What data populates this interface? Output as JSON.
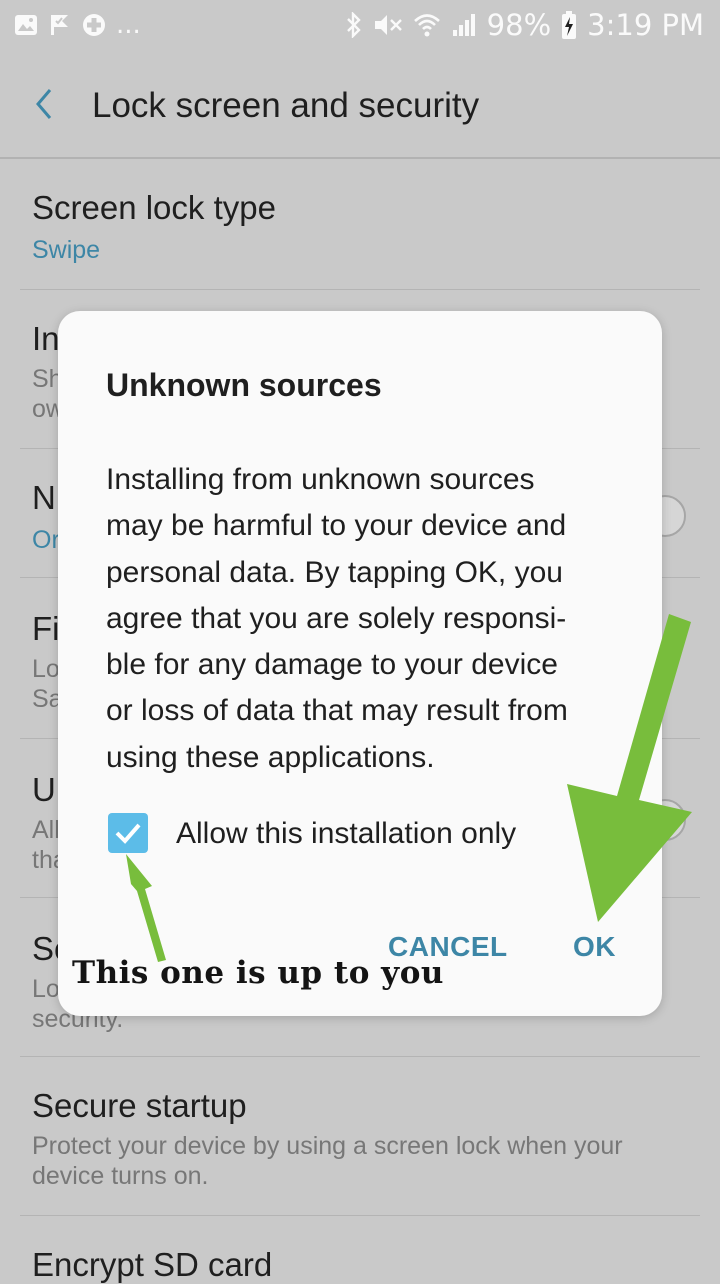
{
  "status_bar": {
    "left_icons": [
      "image-icon",
      "check-flag-icon",
      "medical-cross-icon"
    ],
    "more": "...",
    "battery": "98%",
    "time": "3:19 PM"
  },
  "app_bar": {
    "title": "Lock screen and security"
  },
  "settings": [
    {
      "title": "Screen lock type",
      "subtitle": "Swipe"
    },
    {
      "title": "In",
      "subtitle_lines": [
        "Sh",
        "ow"
      ]
    },
    {
      "title": "N",
      "subtitle": "Or"
    },
    {
      "title": "Fi",
      "subtitle_lines": [
        "Lo",
        "Sa"
      ]
    },
    {
      "title": "U",
      "subtitle_lines": [
        "All",
        "tha"
      ]
    },
    {
      "title": "Se",
      "subtitle_lines": [
        "Lo",
        "security."
      ]
    },
    {
      "title": "Secure startup",
      "subtitle": "Protect your device by using a screen lock when your device turns on."
    },
    {
      "title": "Encrypt SD card"
    }
  ],
  "dialog": {
    "title": "Unknown sources",
    "body": "Installing from unknown sources may be harmful to your device and personal data. By tapping OK, you agree that you are solely responsi­ble for any damage to your device or loss of data that may result from using these applications.",
    "body_lines": [
      "Installing from unknown sources",
      "may be harmful to your device and",
      "personal data. By tapping OK, you",
      "agree that you are solely responsi-",
      "ble for any damage to your device",
      "or loss of data that may result from",
      "using these applications."
    ],
    "checkbox_label": "Allow this installation only",
    "checkbox_checked": true,
    "cancel_label": "CANCEL",
    "ok_label": "OK"
  },
  "annotation": {
    "text": "This one is up to you",
    "arrow_color": "#78bd3c"
  },
  "colors": {
    "accent": "#3d86a6",
    "checkbox": "#5cbce8",
    "scrim_bg": "#c9c9c9"
  }
}
